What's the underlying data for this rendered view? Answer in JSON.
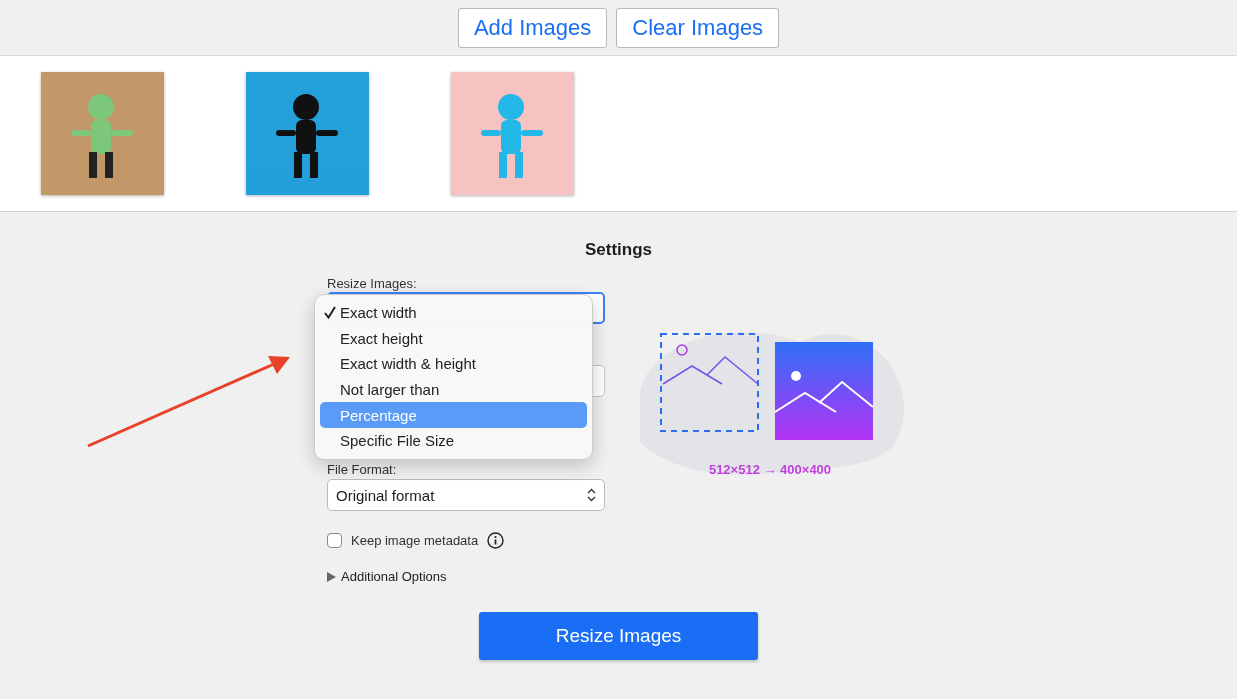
{
  "toolbar": {
    "buttons": [
      "Add Images",
      "Clear Images"
    ]
  },
  "settings": {
    "title": "Settings",
    "resize_label": "Resize Images:",
    "resize_menu": [
      {
        "label": "Exact width",
        "checked": true,
        "selected": false
      },
      {
        "label": "Exact height",
        "checked": false,
        "selected": false
      },
      {
        "label": "Exact width & height",
        "checked": false,
        "selected": false
      },
      {
        "label": "Not larger than",
        "checked": false,
        "selected": false
      },
      {
        "label": "Percentage",
        "checked": false,
        "selected": true
      },
      {
        "label": "Specific File Size",
        "checked": false,
        "selected": false
      }
    ],
    "format_label": "File Format:",
    "format_value": "Original format",
    "metadata": {
      "label": "Keep image metadata",
      "checked": false
    },
    "additional_options": {
      "label": "Additional Options",
      "expanded": false
    },
    "submit": "Resize Images"
  },
  "preview": {
    "caption": "512×512 → 400×400"
  }
}
